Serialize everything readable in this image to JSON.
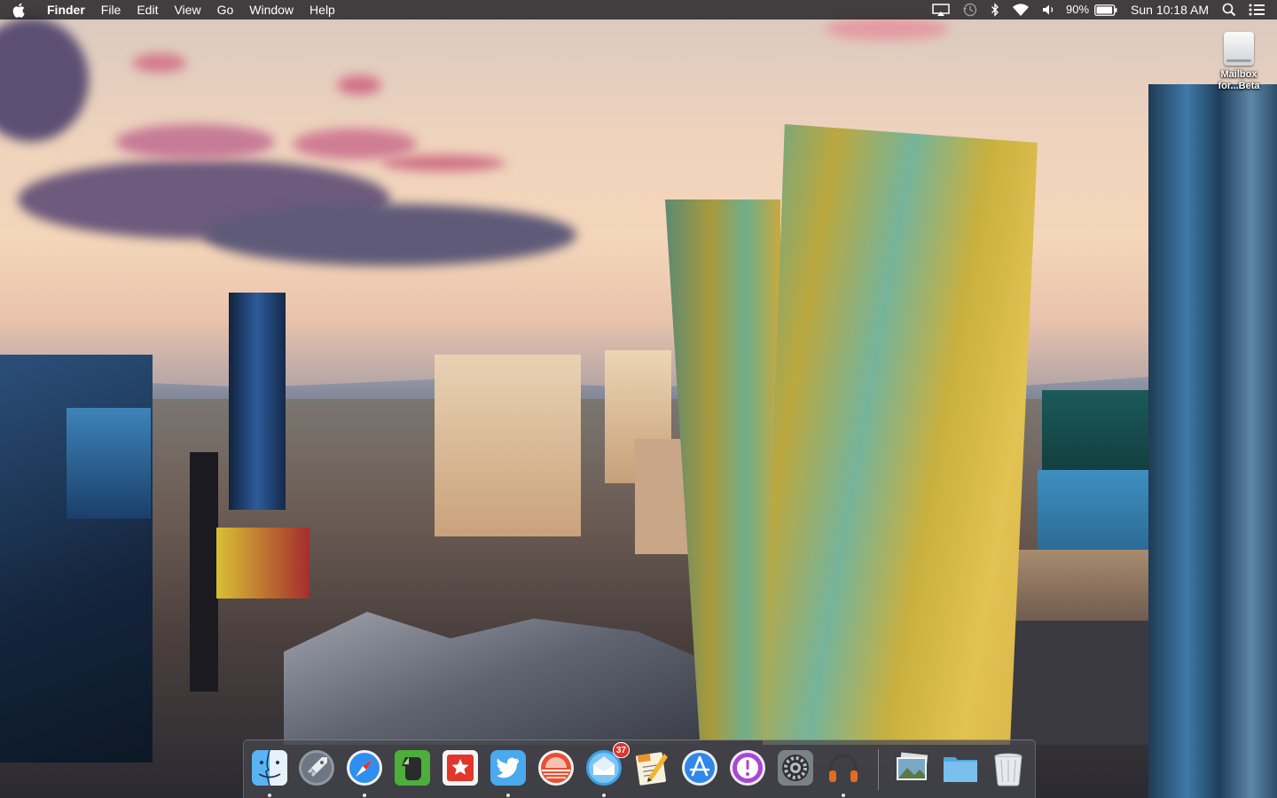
{
  "menubar": {
    "apple_icon": "apple-icon",
    "app_name": "Finder",
    "menus": [
      "File",
      "Edit",
      "View",
      "Go",
      "Window",
      "Help"
    ],
    "status_icons": [
      "airplay-icon",
      "time-machine-icon",
      "bluetooth-icon",
      "wifi-icon",
      "volume-icon"
    ],
    "battery_percent": "90%",
    "battery_level": 0.9,
    "clock": "Sun 10:18 AM",
    "spotlight_icon": "search-icon",
    "notification_icon": "notification-center-icon"
  },
  "desktop": {
    "icons": [
      {
        "label_line1": "Mailbox",
        "label_line2": "for...Beta",
        "icon": "disk-image-icon"
      }
    ]
  },
  "dock": {
    "apps": [
      {
        "name": "Finder",
        "icon": "finder-icon",
        "running": true
      },
      {
        "name": "Launchpad",
        "icon": "launchpad-icon",
        "running": false
      },
      {
        "name": "Safari",
        "icon": "safari-icon",
        "running": true
      },
      {
        "name": "Evernote",
        "icon": "evernote-icon",
        "running": false
      },
      {
        "name": "Reeder",
        "icon": "reeder-icon",
        "running": false
      },
      {
        "name": "Twitter",
        "icon": "twitter-icon",
        "running": true
      },
      {
        "name": "Sunrise",
        "icon": "sunrise-icon",
        "running": false
      },
      {
        "name": "Mail",
        "icon": "mail-icon",
        "running": true,
        "badge": "37"
      },
      {
        "name": "Pages",
        "icon": "pages-icon",
        "running": false
      },
      {
        "name": "App Store",
        "icon": "app-store-icon",
        "running": false
      },
      {
        "name": "Feedback Assistant",
        "icon": "feedback-icon",
        "running": false
      },
      {
        "name": "System Preferences",
        "icon": "system-preferences-icon",
        "running": false
      },
      {
        "name": "Music",
        "icon": "headphones-icon",
        "running": true
      }
    ],
    "stacks": [
      {
        "name": "Photos stack",
        "icon": "photos-stack-icon"
      },
      {
        "name": "Folder",
        "icon": "folder-icon"
      },
      {
        "name": "Trash",
        "icon": "trash-icon"
      }
    ]
  },
  "colors": {
    "menubar_bg": "#26262a",
    "badge_red": "#e0332b",
    "dock_bg": "#46464e"
  }
}
